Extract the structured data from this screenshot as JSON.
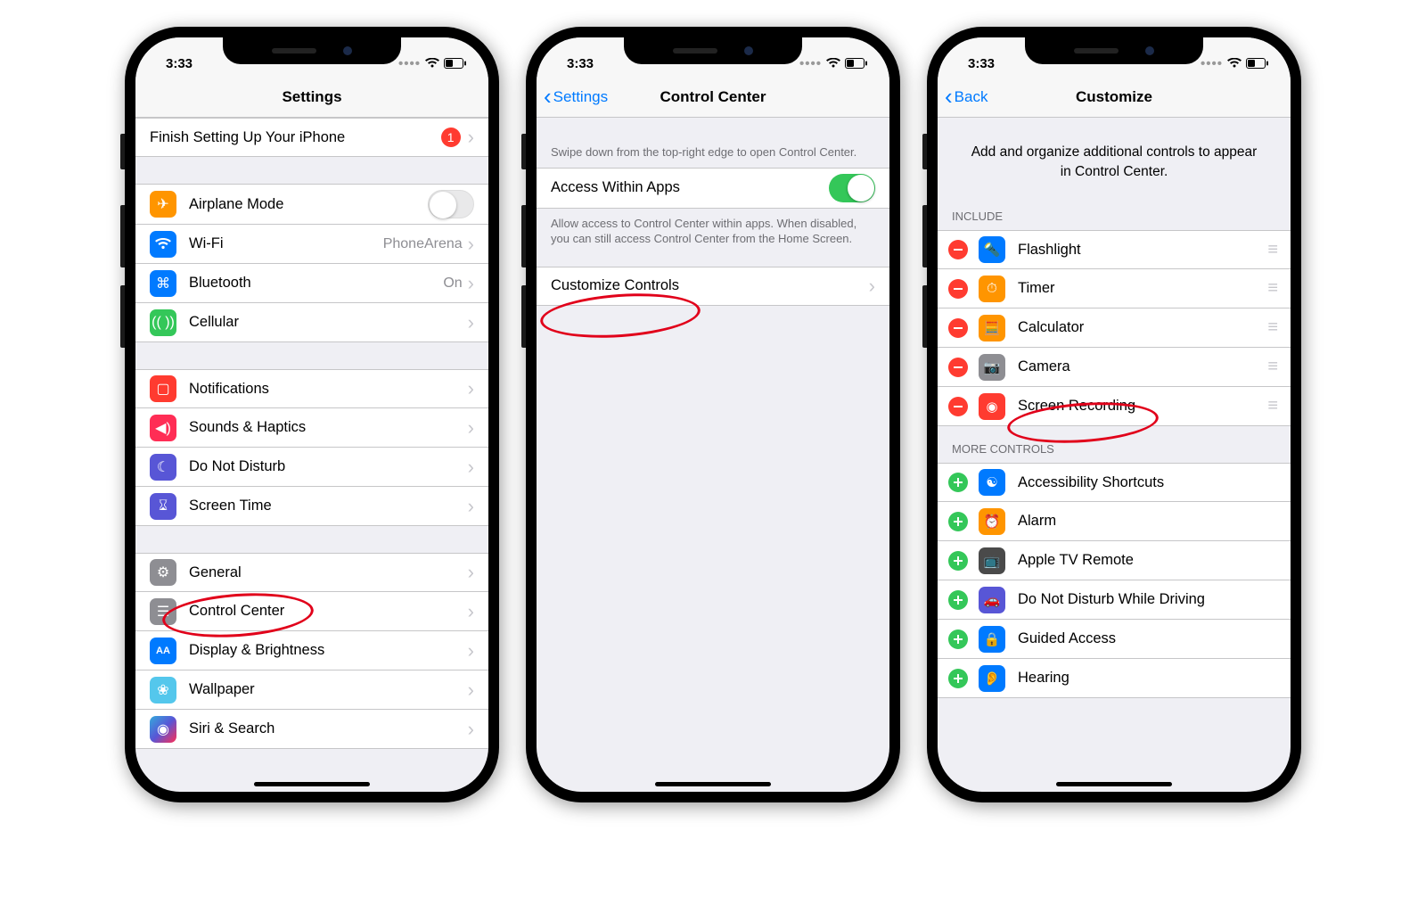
{
  "status": {
    "time": "3:33"
  },
  "phone1": {
    "title": "Settings",
    "finish": {
      "label": "Finish Setting Up Your iPhone",
      "badge": "1"
    },
    "rows": {
      "airplane": {
        "label": "Airplane Mode",
        "color": "#ff9500"
      },
      "wifi": {
        "label": "Wi-Fi",
        "value": "PhoneArena",
        "color": "#007aff"
      },
      "bluetooth": {
        "label": "Bluetooth",
        "value": "On",
        "color": "#007aff"
      },
      "cellular": {
        "label": "Cellular",
        "color": "#34c759"
      },
      "notifications": {
        "label": "Notifications",
        "color": "#ff3b30"
      },
      "sounds": {
        "label": "Sounds & Haptics",
        "color": "#ff2d55"
      },
      "dnd": {
        "label": "Do Not Disturb",
        "color": "#5856d6"
      },
      "screentime": {
        "label": "Screen Time",
        "color": "#5856d6"
      },
      "general": {
        "label": "General",
        "color": "#8e8e93"
      },
      "controlcenter": {
        "label": "Control Center",
        "color": "#8e8e93"
      },
      "display": {
        "label": "Display & Brightness",
        "color": "#007aff"
      },
      "wallpaper": {
        "label": "Wallpaper",
        "color": "#54c7ec"
      },
      "siri": {
        "label": "Siri & Search",
        "color": "#222"
      }
    }
  },
  "phone2": {
    "back": "Settings",
    "title": "Control Center",
    "note1": "Swipe down from the top-right edge to open Control Center.",
    "access": {
      "label": "Access Within Apps"
    },
    "note2": "Allow access to Control Center within apps. When disabled, you can still access Control Center from the Home Screen.",
    "customize": {
      "label": "Customize Controls"
    }
  },
  "phone3": {
    "back": "Back",
    "title": "Customize",
    "intro": "Add and organize additional controls to appear in Control Center.",
    "include_header": "Include",
    "more_header": "More Controls",
    "include": [
      {
        "label": "Flashlight",
        "color": "#007aff",
        "glyph": "flashlight"
      },
      {
        "label": "Timer",
        "color": "#ff9500",
        "glyph": "timer"
      },
      {
        "label": "Calculator",
        "color": "#ff9500",
        "glyph": "calc"
      },
      {
        "label": "Camera",
        "color": "#8e8e93",
        "glyph": "camera"
      },
      {
        "label": "Screen Recording",
        "color": "#ff3b30",
        "glyph": "record"
      }
    ],
    "more": [
      {
        "label": "Accessibility Shortcuts",
        "color": "#007aff",
        "glyph": "access"
      },
      {
        "label": "Alarm",
        "color": "#ff9500",
        "glyph": "alarm"
      },
      {
        "label": "Apple TV Remote",
        "color": "#4a4a4a",
        "glyph": "tv"
      },
      {
        "label": "Do Not Disturb While Driving",
        "color": "#5856d6",
        "glyph": "car"
      },
      {
        "label": "Guided Access",
        "color": "#007aff",
        "glyph": "guided"
      },
      {
        "label": "Hearing",
        "color": "#007aff",
        "glyph": "ear"
      }
    ]
  }
}
